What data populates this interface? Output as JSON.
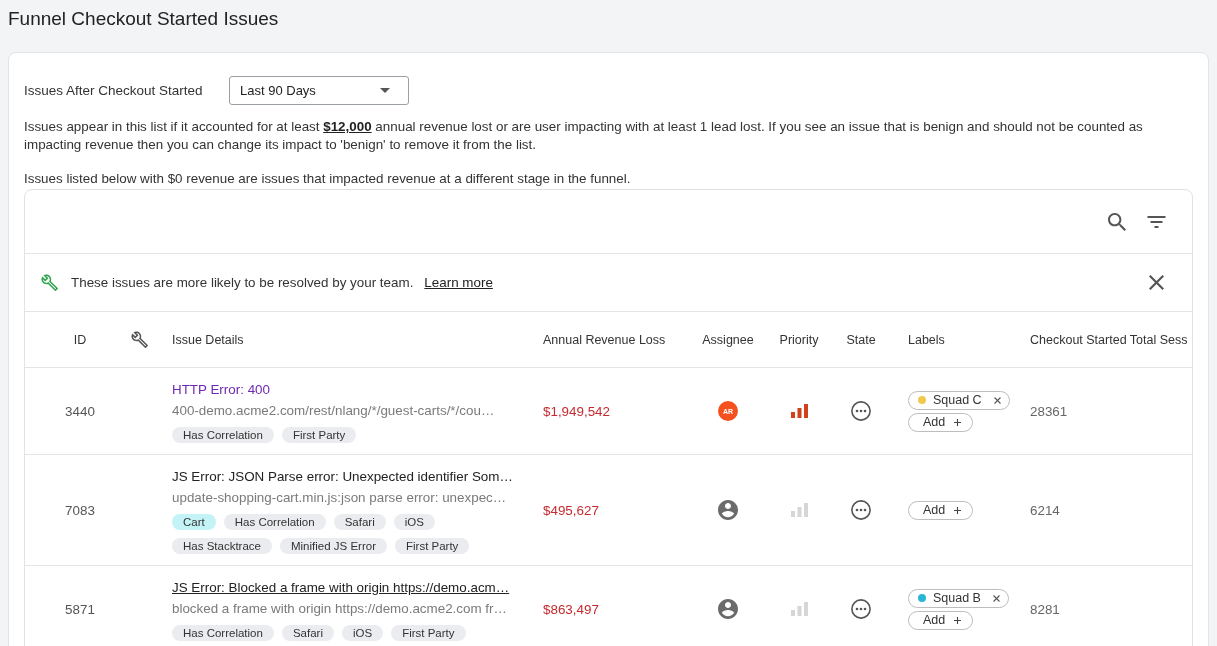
{
  "page": {
    "title": "Funnel Checkout Started Issues"
  },
  "filter": {
    "label": "Issues After Checkout Started",
    "dropdown": {
      "value": "Last 90 Days"
    }
  },
  "notes": [
    "Issues appear in this list if it accounted for at least **$12,000** annual revenue lost or are user impacting with at least 1 lead lost. If you see an issue that is benign and should not be counted as impacting revenue then you can change its impact to 'benign' to remove it from the list.",
    "Issues listed below with $0 revenue are issues that impacted revenue at a different stage in the funnel."
  ],
  "table": {
    "banner": {
      "message": "These issues are more likely to be resolved by your team.",
      "link": "Learn more"
    },
    "columns": [
      {
        "kind": "text",
        "label": "ID"
      },
      {
        "kind": "icon"
      },
      {
        "kind": "text",
        "label": "Issue Details"
      },
      {
        "kind": "text",
        "label": "Annual Revenue Loss"
      },
      {
        "kind": "text",
        "label": "Assignee"
      },
      {
        "kind": "text",
        "label": "Priority"
      },
      {
        "kind": "text",
        "label": "State"
      },
      {
        "kind": "text",
        "label": "Labels"
      },
      {
        "kind": "text",
        "label": "Checkout Started Total Sess"
      }
    ],
    "rows": [
      {
        "id": "3440",
        "title": "HTTP Error: 400",
        "visited": true,
        "hovered": false,
        "subtitle": "400-demo.acme2.com/rest/nlang/*/guest-carts/*/cou…",
        "tags": [
          {
            "label": "Has Correlation",
            "color": "#ebecef"
          },
          {
            "label": "First Party",
            "color": "#ebecef"
          }
        ],
        "revenue": "$1,949,542",
        "assignee": {
          "kind": "initials",
          "initials": "AR"
        },
        "prioritized": true,
        "labels": [
          {
            "name": "Squad C",
            "color": "#f2c94c"
          }
        ],
        "add_label": "Add",
        "sessions": "28361"
      },
      {
        "id": "7083",
        "title": "JS Error: JSON Parse error: Unexpected identifier Som…",
        "visited": false,
        "hovered": false,
        "subtitle": "update-shopping-cart.min.js:json parse error: unexpec…",
        "tags": [
          {
            "label": "Cart",
            "color": "#c4f3f7"
          },
          {
            "label": "Has Correlation",
            "color": "#ebecef"
          },
          {
            "label": "Safari",
            "color": "#ebecef"
          },
          {
            "label": "iOS",
            "color": "#ebecef"
          },
          {
            "label": "Has Stacktrace",
            "color": "#ebecef"
          },
          {
            "label": "Minified JS Error",
            "color": "#ebecef"
          },
          {
            "label": "First Party",
            "color": "#ebecef"
          }
        ],
        "revenue": "$495,627",
        "assignee": {
          "kind": "unassigned"
        },
        "prioritized": false,
        "labels": [],
        "add_label": "Add",
        "sessions": "6214"
      },
      {
        "id": "5871",
        "title": "JS Error: Blocked a frame with origin https://demo.acm…",
        "visited": false,
        "hovered": true,
        "subtitle": "blocked a frame with origin https://demo.acme2.com fr…",
        "tags": [
          {
            "label": "Has Correlation",
            "color": "#ebecef"
          },
          {
            "label": "Safari",
            "color": "#ebecef"
          },
          {
            "label": "iOS",
            "color": "#ebecef"
          },
          {
            "label": "First Party",
            "color": "#ebecef"
          }
        ],
        "revenue": "$863,497",
        "assignee": {
          "kind": "unassigned"
        },
        "prioritized": false,
        "labels": [
          {
            "name": "Squad B",
            "color": "#29b6d6"
          }
        ],
        "add_label": "Add",
        "sessions": "8281"
      }
    ]
  }
}
